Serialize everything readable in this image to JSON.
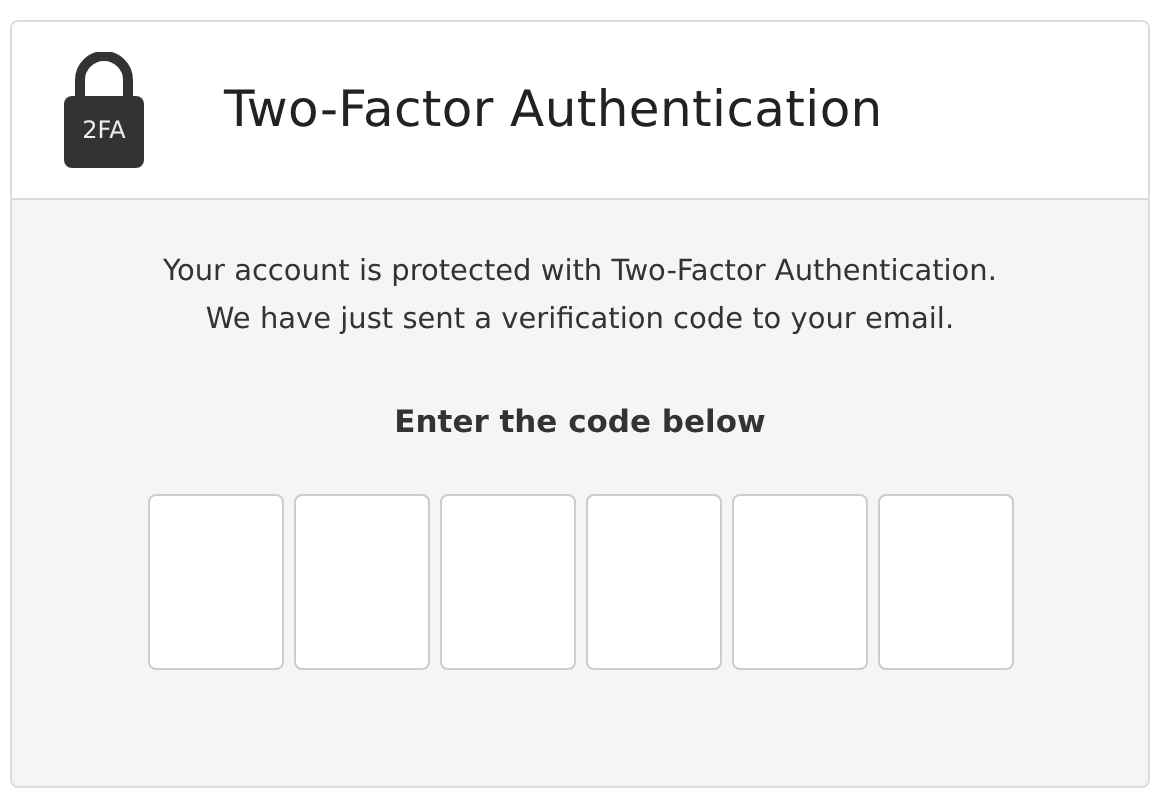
{
  "header": {
    "icon_text": "2FA",
    "title": "Two-Factor Authentication"
  },
  "message": [
    "Your account is protected with Two-Factor Authentication.",
    "We have just sent a verification code to your email."
  ],
  "prompt": "Enter the code below",
  "code_fields": [
    {
      "kind": "digit"
    },
    {
      "kind": "digit"
    },
    {
      "kind": "digit"
    },
    {
      "kind": "digit"
    },
    {
      "kind": "digit"
    },
    {
      "kind": "digit"
    }
  ]
}
